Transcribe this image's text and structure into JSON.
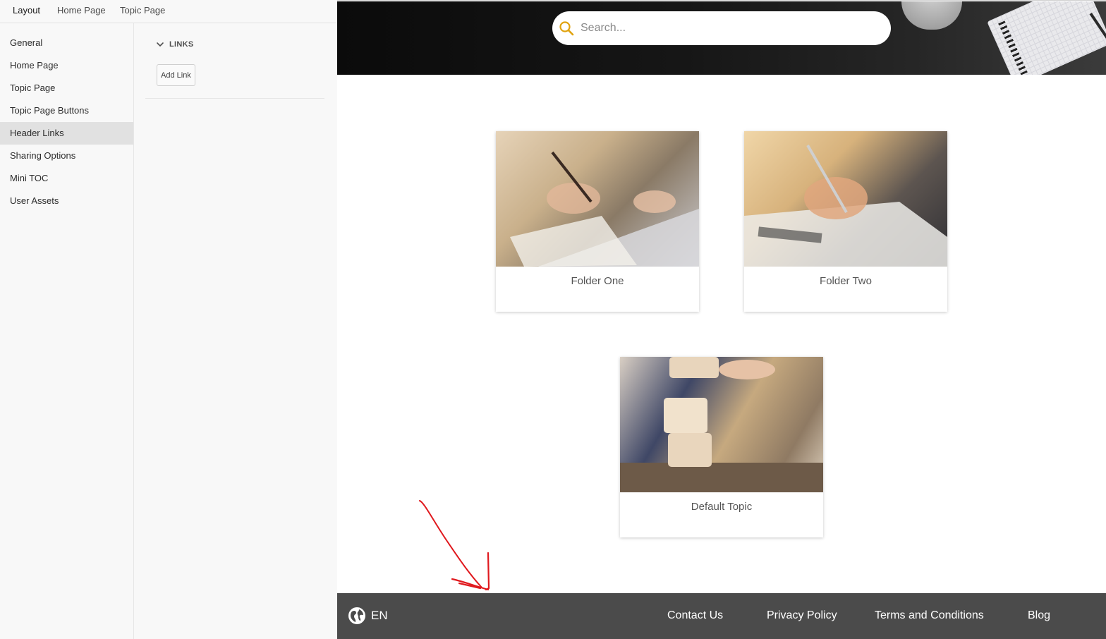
{
  "editor": {
    "top_tabs": [
      "Layout",
      "Home Page",
      "Topic Page"
    ],
    "side_nav": [
      "General",
      "Home Page",
      "Topic Page",
      "Topic Page Buttons",
      "Header Links",
      "Sharing Options",
      "Mini TOC",
      "User Assets"
    ],
    "selected_nav": "Header Links",
    "links_section_title": "LINKS",
    "add_link_label": "Add Link"
  },
  "preview": {
    "search_placeholder": "Search...",
    "tiles": [
      "Folder One",
      "Folder Two",
      "Default Topic"
    ],
    "footer": {
      "language": "EN",
      "links": [
        "Contact Us",
        "Privacy Policy",
        "Terms and Conditions",
        "Blog"
      ]
    }
  },
  "colors": {
    "footer_bg": "#4b4b4b",
    "search_icon": "#e0a30f",
    "annotation_arrow": "#e0191e",
    "selected_nav_bg": "#e1e1e1"
  }
}
